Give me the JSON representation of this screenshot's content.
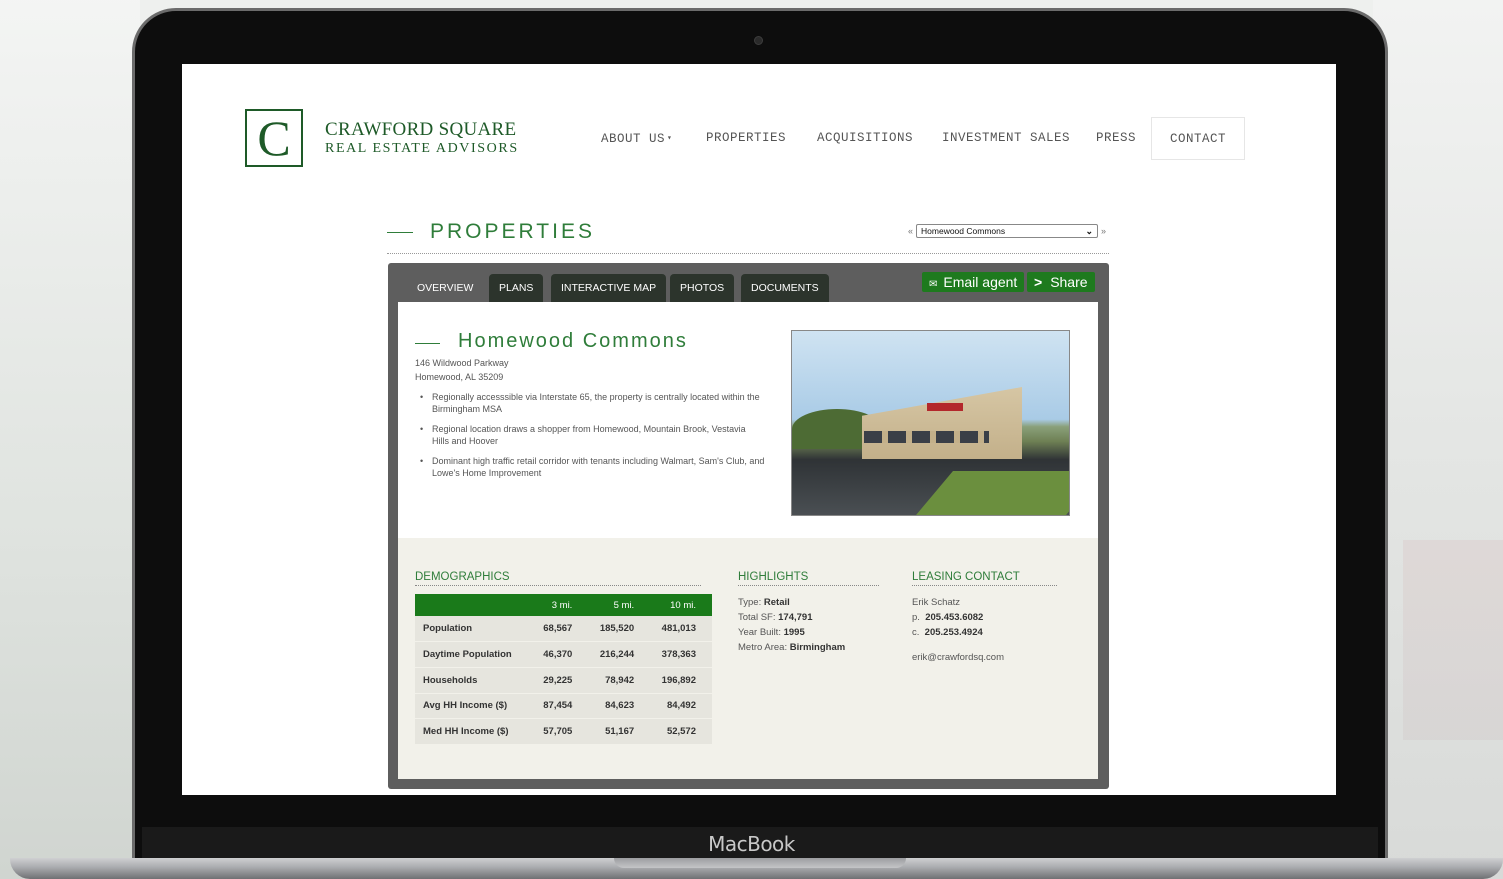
{
  "device": {
    "label": "MacBook"
  },
  "logo": {
    "letter": "C",
    "line1": "CRAWFORD SQUARE",
    "line2": "REAL ESTATE ADVISORS"
  },
  "nav": {
    "items": [
      "ABOUT US",
      "PROPERTIES",
      "ACQUISITIONS",
      "INVESTMENT SALES",
      "PRESS",
      "CONTACT"
    ],
    "dropdown_caret": "▾"
  },
  "section": {
    "title": "PROPERTIES",
    "prev": "«",
    "next": "»",
    "selected_property": "Homewood Commons"
  },
  "tabs": [
    "OVERVIEW",
    "PLANS",
    "INTERACTIVE MAP",
    "PHOTOS",
    "DOCUMENTS"
  ],
  "actions": {
    "email": "Email agent",
    "share": "Share",
    "share_glyph": ">"
  },
  "property": {
    "name": "Homewood Commons",
    "address1": "146 Wildwood Parkway",
    "address2": "Homewood, AL 35209",
    "bullets": [
      "Regionally accesssible via Interstate 65, the property is centrally located within the Birmingham MSA",
      "Regional location draws a shopper from Homewood, Mountain Brook, Vestavia Hills and Hoover",
      "Dominant high traffic retail corridor with tenants including Walmart, Sam's Club, and Lowe's Home Improvement"
    ]
  },
  "demographics": {
    "title": "DEMOGRAPHICS",
    "headers": [
      "",
      "3 mi.",
      "5 mi.",
      "10 mi."
    ],
    "rows": [
      [
        "Population",
        "68,567",
        "185,520",
        "481,013"
      ],
      [
        "Daytime Population",
        "46,370",
        "216,244",
        "378,363"
      ],
      [
        "Households",
        "29,225",
        "78,942",
        "196,892"
      ],
      [
        "Avg HH Income ($)",
        "87,454",
        "84,623",
        "84,492"
      ],
      [
        "Med HH Income ($)",
        "57,705",
        "51,167",
        "52,572"
      ]
    ]
  },
  "highlights": {
    "title": "HIGHLIGHTS",
    "type_label": "Type:",
    "type_value": "Retail",
    "sf_label": "Total SF:",
    "sf_value": "174,791",
    "year_label": "Year Built:",
    "year_value": "1995",
    "metro_label": "Metro Area:",
    "metro_value": "Birmingham"
  },
  "leasing": {
    "title": "LEASING CONTACT",
    "name": "Erik Schatz",
    "phone_label": "p.",
    "phone": "205.453.6082",
    "cell_label": "c.",
    "cell": "205.253.4924",
    "email": "erik@crawfordsq.com"
  }
}
